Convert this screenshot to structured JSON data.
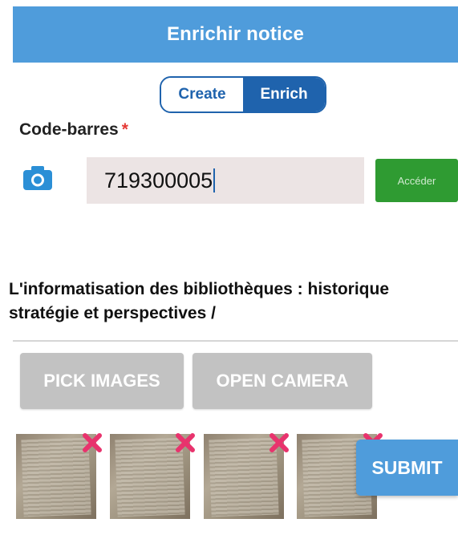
{
  "header": {
    "title": "Enrichir notice"
  },
  "mode_toggle": {
    "options": [
      {
        "label": "Create",
        "selected": false
      },
      {
        "label": "Enrich",
        "selected": true
      }
    ]
  },
  "barcode": {
    "label": "Code-barres",
    "required_marker": "*",
    "value": "719300005",
    "submit_label": "Accéder",
    "camera_icon": "camera-icon"
  },
  "book": {
    "title_line1": "L'informatisation des bibliothèques : historique",
    "title_line2": "stratégie et perspectives /"
  },
  "actions": {
    "pick_images": "PICK IMAGES",
    "open_camera": "OPEN CAMERA",
    "submit": "SUBMIT"
  },
  "thumbnails": [
    {
      "name": "page-photo-1",
      "removable": true
    },
    {
      "name": "page-photo-2",
      "removable": true
    },
    {
      "name": "page-photo-3",
      "removable": true
    },
    {
      "name": "page-photo-4",
      "removable": true
    }
  ],
  "colors": {
    "primary": "#4f9cdb",
    "toggle": "#1f63ad",
    "accent_green": "#2f9b32",
    "remove": "#e8336d",
    "input_bg": "#ece4e4",
    "disabled_button": "#c2c2c2"
  }
}
